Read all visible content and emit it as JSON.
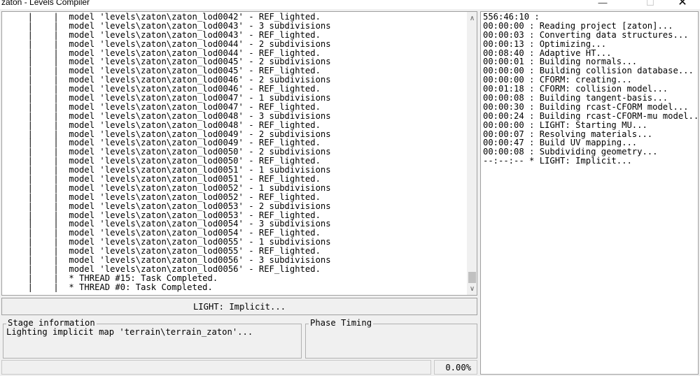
{
  "window": {
    "title": "zaton - Levels Compiler",
    "minimize_glyph": "—",
    "maximize_glyph": "☐",
    "close_glyph": "✕"
  },
  "log": {
    "lines": [
      "     |    |  model 'levels\\zaton\\zaton_lod0042' - REF_lighted.",
      "     |    |  model 'levels\\zaton\\zaton_lod0043' - 3 subdivisions",
      "     |    |  model 'levels\\zaton\\zaton_lod0043' - REF_lighted.",
      "     |    |  model 'levels\\zaton\\zaton_lod0044' - 2 subdivisions",
      "     |    |  model 'levels\\zaton\\zaton_lod0044' - REF_lighted.",
      "     |    |  model 'levels\\zaton\\zaton_lod0045' - 2 subdivisions",
      "     |    |  model 'levels\\zaton\\zaton_lod0045' - REF_lighted.",
      "     |    |  model 'levels\\zaton\\zaton_lod0046' - 2 subdivisions",
      "     |    |  model 'levels\\zaton\\zaton_lod0046' - REF_lighted.",
      "     |    |  model 'levels\\zaton\\zaton_lod0047' - 1 subdivisions",
      "     |    |  model 'levels\\zaton\\zaton_lod0047' - REF_lighted.",
      "     |    |  model 'levels\\zaton\\zaton_lod0048' - 3 subdivisions",
      "     |    |  model 'levels\\zaton\\zaton_lod0048' - REF_lighted.",
      "     |    |  model 'levels\\zaton\\zaton_lod0049' - 2 subdivisions",
      "     |    |  model 'levels\\zaton\\zaton_lod0049' - REF_lighted.",
      "     |    |  model 'levels\\zaton\\zaton_lod0050' - 2 subdivisions",
      "     |    |  model 'levels\\zaton\\zaton_lod0050' - REF_lighted.",
      "     |    |  model 'levels\\zaton\\zaton_lod0051' - 1 subdivisions",
      "     |    |  model 'levels\\zaton\\zaton_lod0051' - REF_lighted.",
      "     |    |  model 'levels\\zaton\\zaton_lod0052' - 1 subdivisions",
      "     |    |  model 'levels\\zaton\\zaton_lod0052' - REF_lighted.",
      "     |    |  model 'levels\\zaton\\zaton_lod0053' - 2 subdivisions",
      "     |    |  model 'levels\\zaton\\zaton_lod0053' - REF_lighted.",
      "     |    |  model 'levels\\zaton\\zaton_lod0054' - 3 subdivisions",
      "     |    |  model 'levels\\zaton\\zaton_lod0054' - REF_lighted.",
      "     |    |  model 'levels\\zaton\\zaton_lod0055' - 1 subdivisions",
      "     |    |  model 'levels\\zaton\\zaton_lod0055' - REF_lighted.",
      "     |    |  model 'levels\\zaton\\zaton_lod0056' - 3 subdivisions",
      "     |    |  model 'levels\\zaton\\zaton_lod0056' - REF_lighted.",
      "     |    |  * THREAD #15: Task Completed.",
      "     |    |  * THREAD #0: Task Completed."
    ],
    "scroll_up_glyph": "∧",
    "scroll_down_glyph": "∨"
  },
  "phase": {
    "text": "LIGHT: Implicit..."
  },
  "stage": {
    "legend": "Stage information",
    "text": "Lighting implicit map 'terrain\\terrain_zaton'..."
  },
  "timing": {
    "legend": "Phase Timing"
  },
  "status": {
    "left": "",
    "progress": "0.00%"
  },
  "phases_log": {
    "lines": [
      "556:46:10 :",
      "00:00:00 : Reading project [zaton]...",
      "00:00:03 : Converting data structures...",
      "00:00:13 : Optimizing...",
      "00:08:40 : Adaptive HT...",
      "00:00:01 : Building normals...",
      "00:00:00 : Building collision database...",
      "00:00:00 : CFORM: creating...",
      "00:01:18 : CFORM: collision model...",
      "00:00:08 : Building tangent-basis...",
      "00:00:30 : Building rcast-CFORM model...",
      "00:00:24 : Building rcast-CFORM-mu model...",
      "00:00:00 : LIGHT: Starting MU...",
      "00:00:07 : Resolving materials...",
      "00:00:47 : Build UV mapping...",
      "00:00:08 : Subdividing geometry...",
      "--:--:-- * LIGHT: Implicit..."
    ]
  }
}
